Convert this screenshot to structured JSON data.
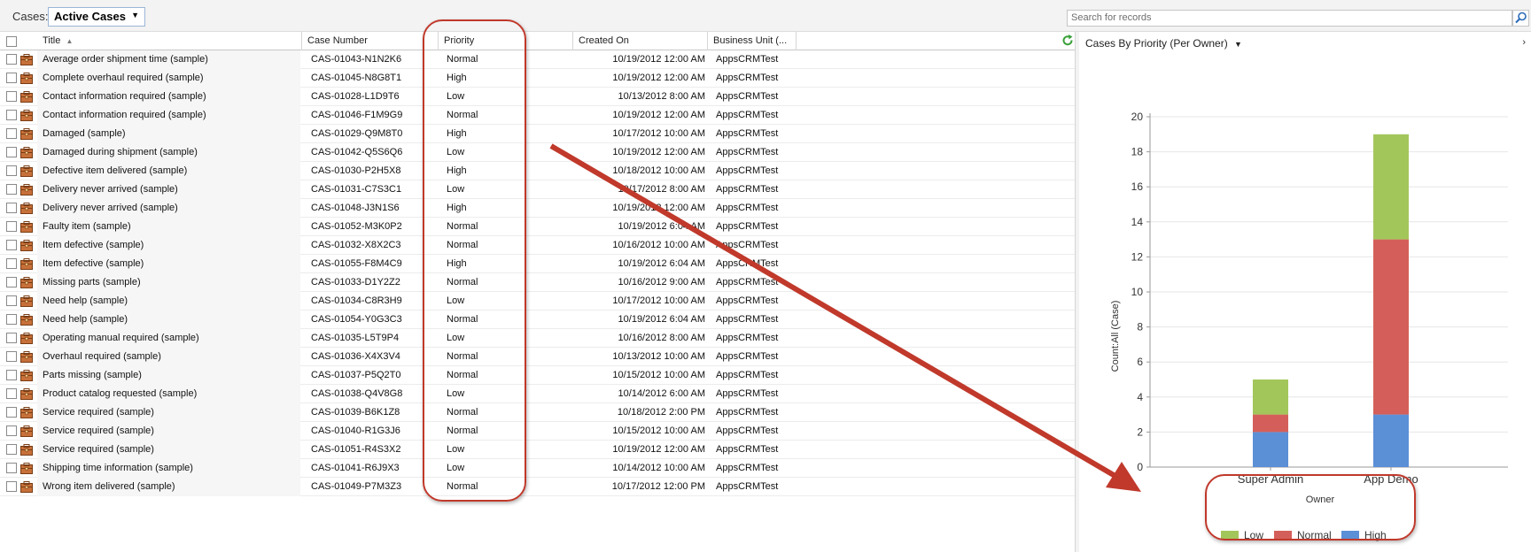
{
  "header": {
    "cases_label": "Cases:",
    "view_name": "Active Cases",
    "search_placeholder": "Search for records"
  },
  "grid": {
    "columns": [
      "Title",
      "Case Number",
      "Priority",
      "Created On",
      "Business Unit (..."
    ],
    "rows": [
      {
        "title": "Average order shipment time (sample)",
        "case_number": "CAS-01043-N1N2K6",
        "priority": "Normal",
        "created_on": "10/19/2012 12:00 AM",
        "business_unit": "AppsCRMTest"
      },
      {
        "title": "Complete overhaul required (sample)",
        "case_number": "CAS-01045-N8G8T1",
        "priority": "High",
        "created_on": "10/19/2012 12:00 AM",
        "business_unit": "AppsCRMTest"
      },
      {
        "title": "Contact information required (sample)",
        "case_number": "CAS-01028-L1D9T6",
        "priority": "Low",
        "created_on": "10/13/2012 8:00 AM",
        "business_unit": "AppsCRMTest"
      },
      {
        "title": "Contact information required (sample)",
        "case_number": "CAS-01046-F1M9G9",
        "priority": "Normal",
        "created_on": "10/19/2012 12:00 AM",
        "business_unit": "AppsCRMTest"
      },
      {
        "title": "Damaged (sample)",
        "case_number": "CAS-01029-Q9M8T0",
        "priority": "High",
        "created_on": "10/17/2012 10:00 AM",
        "business_unit": "AppsCRMTest"
      },
      {
        "title": "Damaged during shipment (sample)",
        "case_number": "CAS-01042-Q5S6Q6",
        "priority": "Low",
        "created_on": "10/19/2012 12:00 AM",
        "business_unit": "AppsCRMTest"
      },
      {
        "title": "Defective item delivered (sample)",
        "case_number": "CAS-01030-P2H5X8",
        "priority": "High",
        "created_on": "10/18/2012 10:00 AM",
        "business_unit": "AppsCRMTest"
      },
      {
        "title": "Delivery never arrived (sample)",
        "case_number": "CAS-01031-C7S3C1",
        "priority": "Low",
        "created_on": "10/17/2012 8:00 AM",
        "business_unit": "AppsCRMTest"
      },
      {
        "title": "Delivery never arrived (sample)",
        "case_number": "CAS-01048-J3N1S6",
        "priority": "High",
        "created_on": "10/19/2012 12:00 AM",
        "business_unit": "AppsCRMTest"
      },
      {
        "title": "Faulty item (sample)",
        "case_number": "CAS-01052-M3K0P2",
        "priority": "Normal",
        "created_on": "10/19/2012 6:04 AM",
        "business_unit": "AppsCRMTest"
      },
      {
        "title": "Item defective (sample)",
        "case_number": "CAS-01032-X8X2C3",
        "priority": "Normal",
        "created_on": "10/16/2012 10:00 AM",
        "business_unit": "AppsCRMTest"
      },
      {
        "title": "Item defective (sample)",
        "case_number": "CAS-01055-F8M4C9",
        "priority": "High",
        "created_on": "10/19/2012 6:04 AM",
        "business_unit": "AppsCRMTest"
      },
      {
        "title": "Missing parts (sample)",
        "case_number": "CAS-01033-D1Y2Z2",
        "priority": "Normal",
        "created_on": "10/16/2012 9:00 AM",
        "business_unit": "AppsCRMTest"
      },
      {
        "title": "Need help (sample)",
        "case_number": "CAS-01034-C8R3H9",
        "priority": "Low",
        "created_on": "10/17/2012 10:00 AM",
        "business_unit": "AppsCRMTest"
      },
      {
        "title": "Need help (sample)",
        "case_number": "CAS-01054-Y0G3C3",
        "priority": "Normal",
        "created_on": "10/19/2012 6:04 AM",
        "business_unit": "AppsCRMTest"
      },
      {
        "title": "Operating manual required (sample)",
        "case_number": "CAS-01035-L5T9P4",
        "priority": "Low",
        "created_on": "10/16/2012 8:00 AM",
        "business_unit": "AppsCRMTest"
      },
      {
        "title": "Overhaul required (sample)",
        "case_number": "CAS-01036-X4X3V4",
        "priority": "Normal",
        "created_on": "10/13/2012 10:00 AM",
        "business_unit": "AppsCRMTest"
      },
      {
        "title": "Parts missing (sample)",
        "case_number": "CAS-01037-P5Q2T0",
        "priority": "Normal",
        "created_on": "10/15/2012 10:00 AM",
        "business_unit": "AppsCRMTest"
      },
      {
        "title": "Product catalog requested (sample)",
        "case_number": "CAS-01038-Q4V8G8",
        "priority": "Low",
        "created_on": "10/14/2012 6:00 AM",
        "business_unit": "AppsCRMTest"
      },
      {
        "title": "Service required (sample)",
        "case_number": "CAS-01039-B6K1Z8",
        "priority": "Normal",
        "created_on": "10/18/2012 2:00 PM",
        "business_unit": "AppsCRMTest"
      },
      {
        "title": "Service required (sample)",
        "case_number": "CAS-01040-R1G3J6",
        "priority": "Normal",
        "created_on": "10/15/2012 10:00 AM",
        "business_unit": "AppsCRMTest"
      },
      {
        "title": "Service required (sample)",
        "case_number": "CAS-01051-R4S3X2",
        "priority": "Low",
        "created_on": "10/19/2012 12:00 AM",
        "business_unit": "AppsCRMTest"
      },
      {
        "title": "Shipping time information (sample)",
        "case_number": "CAS-01041-R6J9X3",
        "priority": "Low",
        "created_on": "10/14/2012 10:00 AM",
        "business_unit": "AppsCRMTest"
      },
      {
        "title": "Wrong item delivered (sample)",
        "case_number": "CAS-01049-P7M3Z3",
        "priority": "Normal",
        "created_on": "10/17/2012 12:00 PM",
        "business_unit": "AppsCRMTest"
      }
    ]
  },
  "chart_pane": {
    "title": "Cases By Priority (Per Owner)"
  },
  "chart_data": {
    "type": "bar",
    "stacked": true,
    "categories": [
      "Super Admin",
      "App Demo"
    ],
    "series": [
      {
        "name": "High",
        "values": [
          2,
          3
        ],
        "color": "#5b8fd6"
      },
      {
        "name": "Normal",
        "values": [
          1,
          10
        ],
        "color": "#d45f5a"
      },
      {
        "name": "Low",
        "values": [
          2,
          6
        ],
        "color": "#a3c65b"
      }
    ],
    "legend_order": [
      "Low",
      "Normal",
      "High"
    ],
    "xlabel": "Owner",
    "ylabel": "Count:All (Case)",
    "ylim": [
      0,
      20
    ],
    "yticks": [
      0,
      2,
      4,
      6,
      8,
      10,
      12,
      14,
      16,
      18,
      20
    ],
    "grid": true,
    "legend_position": "bottom"
  },
  "colors": {
    "annotation": "#c0392b",
    "accent_border": "#9ab6d6"
  }
}
